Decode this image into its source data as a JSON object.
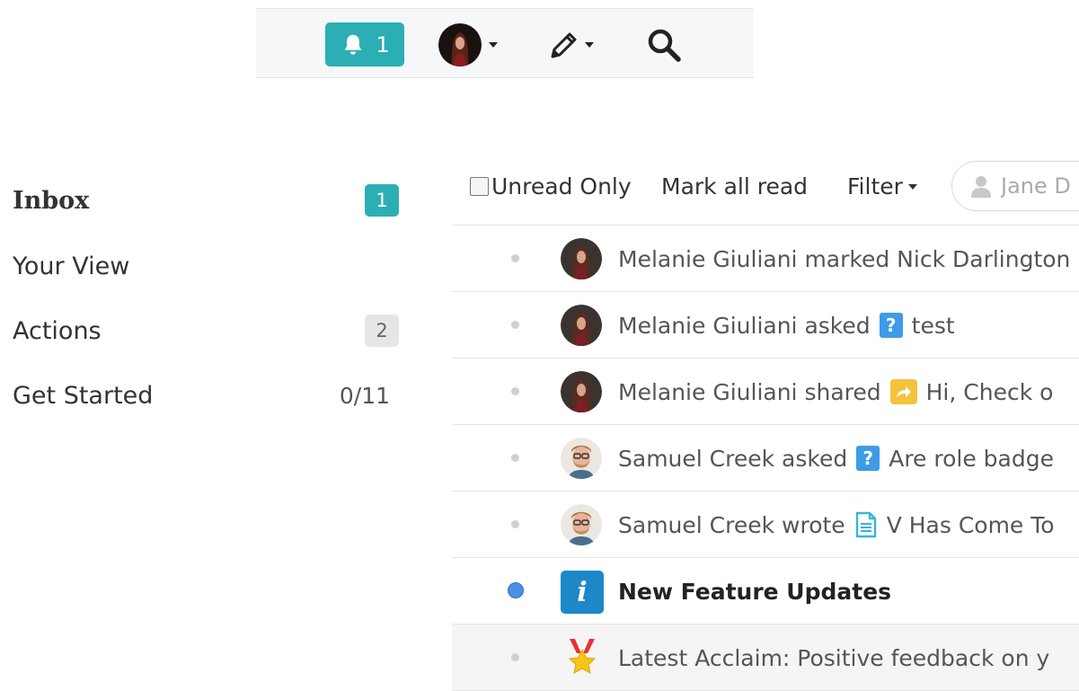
{
  "toolbar": {
    "notification_count": "1"
  },
  "sidebar": {
    "items": [
      {
        "label": "Inbox",
        "badge": "1"
      },
      {
        "label": "Your View"
      },
      {
        "label": "Actions",
        "badge": "2"
      },
      {
        "label": "Get Started",
        "count": "0/11"
      }
    ]
  },
  "filterbar": {
    "unread_only": "Unread Only",
    "mark_all_read": "Mark all read",
    "filter": "Filter",
    "user_search_value": "Jane D"
  },
  "feed": [
    {
      "text": "Melanie Giuliani marked Nick Darlington",
      "avatar": "melanie"
    },
    {
      "actor_action": "Melanie Giuliani asked",
      "icon": "question-icon",
      "title": "test",
      "avatar": "melanie"
    },
    {
      "actor_action": "Melanie Giuliani shared",
      "icon": "share-icon",
      "title": "Hi,  Check o",
      "avatar": "melanie"
    },
    {
      "actor_action": "Samuel Creek asked",
      "icon": "question-icon",
      "title": "Are role badge",
      "avatar": "samuel"
    },
    {
      "actor_action": "Samuel Creek wrote",
      "icon": "document-icon",
      "title": "V Has Come To",
      "avatar": "samuel"
    },
    {
      "text": "New Feature Updates",
      "icon": "info-icon",
      "unread": true
    },
    {
      "text": "Latest Acclaim: Positive feedback on y",
      "icon": "award-star-icon"
    }
  ],
  "colors": {
    "teal": "#2bafb4",
    "info_blue": "#1c88c7",
    "question_blue": "#3d9be9",
    "share_yellow": "#f4c23b",
    "doc_cyan": "#38b6d9",
    "unread_dot": "#4a90e2"
  }
}
